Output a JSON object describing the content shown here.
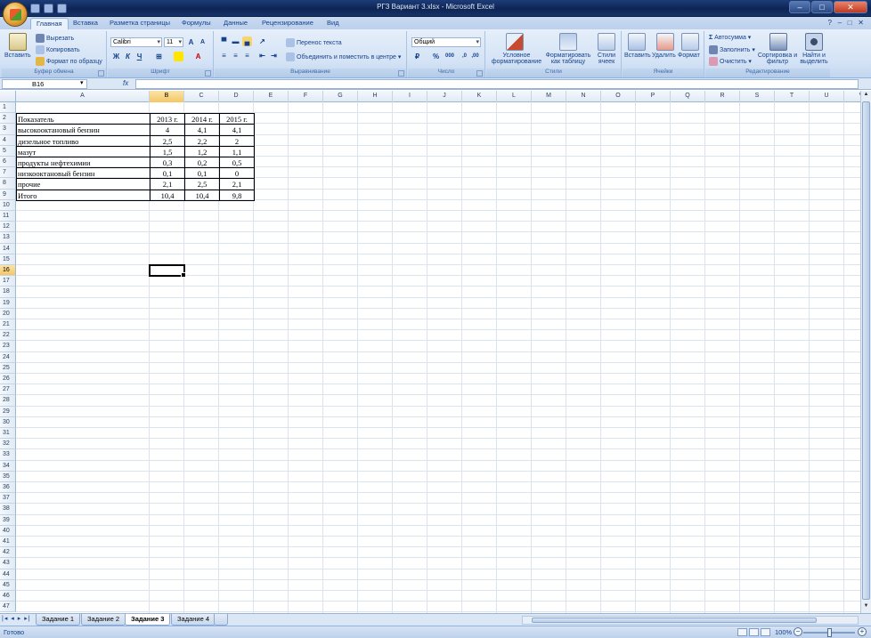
{
  "window": {
    "title": "РГЗ Вариант 3.xlsx - Microsoft Excel",
    "min": "–",
    "max": "□",
    "close": "✕"
  },
  "ribbon_tabs": [
    "Главная",
    "Вставка",
    "Разметка страницы",
    "Формулы",
    "Данные",
    "Рецензирование",
    "Вид"
  ],
  "ribbon": {
    "clipboard": {
      "paste": "Вставить",
      "cut": "Вырезать",
      "copy": "Копировать",
      "format_painter": "Формат по образцу",
      "label": "Буфер обмена"
    },
    "font": {
      "name": "Calibri",
      "size": "11",
      "bold": "Ж",
      "italic": "К",
      "underline": "Ч",
      "label": "Шрифт"
    },
    "alignment": {
      "wrap": "Перенос текста",
      "merge": "Объединить и поместить в центре",
      "label": "Выравнивание"
    },
    "number": {
      "format": "Общий",
      "percent": "%",
      "thousands": "000",
      "label": "Число"
    },
    "styles": {
      "conditional": "Условное форматирование",
      "as_table": "Форматировать как таблицу",
      "cell_styles": "Стили ячеек",
      "label": "Стили"
    },
    "cells": {
      "insert": "Вставить",
      "delete": "Удалить",
      "format": "Формат",
      "label": "Ячейки"
    },
    "editing": {
      "autosum": "Автосумма",
      "fill": "Заполнить",
      "clear": "Очистить",
      "sort": "Сортировка и фильтр",
      "find": "Найти и выделить",
      "label": "Редактирование"
    }
  },
  "formula_bar": {
    "name_box": "B16",
    "fx": "fx",
    "value": ""
  },
  "columns": [
    "A",
    "B",
    "C",
    "D",
    "E",
    "F",
    "G",
    "H",
    "I",
    "J",
    "K",
    "L",
    "M",
    "N",
    "O",
    "P",
    "Q",
    "R",
    "S",
    "T",
    "U",
    "V"
  ],
  "selected_column": "B",
  "selected_row": 16,
  "row_count": 47,
  "table": {
    "header": [
      "Показатель",
      "2013 г.",
      "2014 г.",
      "2015 г."
    ],
    "rows": [
      [
        "высокооктановый бензин",
        "4",
        "4,1",
        "4,1"
      ],
      [
        "дизельное топливо",
        "2,5",
        "2,2",
        "2"
      ],
      [
        "мазут",
        "1,5",
        "1,2",
        "1,1"
      ],
      [
        "продукты нефтехимии",
        "0,3",
        "0,2",
        "0,5"
      ],
      [
        "низкооктановый бензин",
        "0,1",
        "0,1",
        "0"
      ],
      [
        "прочие",
        "2,1",
        "2,5",
        "2,1"
      ],
      [
        "Итого",
        "10,4",
        "10,4",
        "9,8"
      ]
    ]
  },
  "sheets": [
    "Задание 1",
    "Задание 2",
    "Задание 3",
    "Задание 4"
  ],
  "active_sheet": "Задание 3",
  "status": {
    "ready": "Готово",
    "zoom": "100%"
  }
}
